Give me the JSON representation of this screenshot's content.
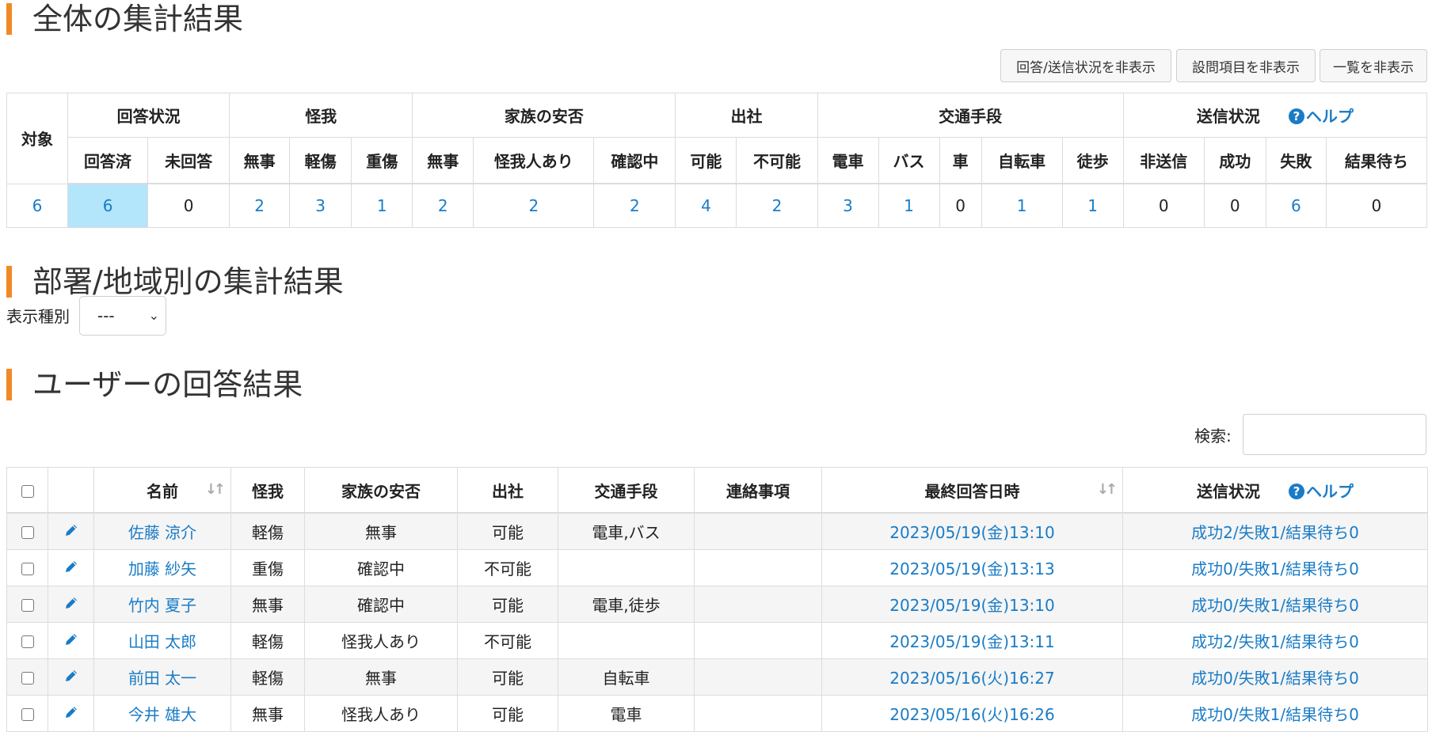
{
  "sections": {
    "overall": "全体の集計結果",
    "dept": "部署/地域別の集計結果",
    "users": "ユーザーの回答結果"
  },
  "buttons": {
    "hide_status": "回答/送信状況を非表示",
    "hide_questions": "設問項目を非表示",
    "hide_list": "一覧を非表示"
  },
  "summary": {
    "groups": {
      "answer_status": "回答状況",
      "injury": "怪我",
      "family": "家族の安否",
      "attendance": "出社",
      "transport": "交通手段",
      "send_status": "送信状況"
    },
    "help": "ヘルプ",
    "columns": [
      "対象",
      "回答済",
      "未回答",
      "無事",
      "軽傷",
      "重傷",
      "無事",
      "怪我人あり",
      "確認中",
      "可能",
      "不可能",
      "電車",
      "バス",
      "車",
      "自転車",
      "徒歩",
      "非送信",
      "成功",
      "失敗",
      "結果待ち"
    ],
    "values": [
      "6",
      "6",
      "0",
      "2",
      "3",
      "1",
      "2",
      "2",
      "2",
      "4",
      "2",
      "3",
      "1",
      "0",
      "1",
      "1",
      "0",
      "0",
      "6",
      "0"
    ]
  },
  "filter": {
    "label": "表示種別",
    "selected": "---"
  },
  "search": {
    "label": "検索:"
  },
  "users_table": {
    "headers": {
      "name": "名前",
      "injury": "怪我",
      "family": "家族の安否",
      "attendance": "出社",
      "transport": "交通手段",
      "notes": "連絡事項",
      "last_answer": "最終回答日時",
      "send_status": "送信状況",
      "help": "ヘルプ"
    },
    "rows": [
      {
        "name": "佐藤 涼介",
        "injury": "軽傷",
        "family": "無事",
        "attendance": "可能",
        "transport": "電車,バス",
        "notes": "",
        "last_answer": "2023/05/19(金)13:10",
        "send_status": "成功2/失敗1/結果待ち0"
      },
      {
        "name": "加藤 紗矢",
        "injury": "重傷",
        "family": "確認中",
        "attendance": "不可能",
        "transport": "",
        "notes": "",
        "last_answer": "2023/05/19(金)13:13",
        "send_status": "成功0/失敗1/結果待ち0"
      },
      {
        "name": "竹内 夏子",
        "injury": "無事",
        "family": "確認中",
        "attendance": "可能",
        "transport": "電車,徒歩",
        "notes": "",
        "last_answer": "2023/05/19(金)13:10",
        "send_status": "成功0/失敗1/結果待ち0"
      },
      {
        "name": "山田 太郎",
        "injury": "軽傷",
        "family": "怪我人あり",
        "attendance": "不可能",
        "transport": "",
        "notes": "",
        "last_answer": "2023/05/19(金)13:11",
        "send_status": "成功2/失敗1/結果待ち0"
      },
      {
        "name": "前田 太一",
        "injury": "軽傷",
        "family": "無事",
        "attendance": "可能",
        "transport": "自転車",
        "notes": "",
        "last_answer": "2023/05/16(火)16:27",
        "send_status": "成功0/失敗1/結果待ち0"
      },
      {
        "name": "今井 雄大",
        "injury": "無事",
        "family": "怪我人あり",
        "attendance": "可能",
        "transport": "電車",
        "notes": "",
        "last_answer": "2023/05/16(火)16:26",
        "send_status": "成功0/失敗1/結果待ち0"
      }
    ]
  },
  "colors": {
    "accent": "#f08a24",
    "link": "#1a7cc6",
    "highlight": "#b3e5fb"
  },
  "icons": {
    "row_edit": "pencil-icon",
    "help": "question-circle-icon",
    "sort": "sort-arrows-icon"
  }
}
